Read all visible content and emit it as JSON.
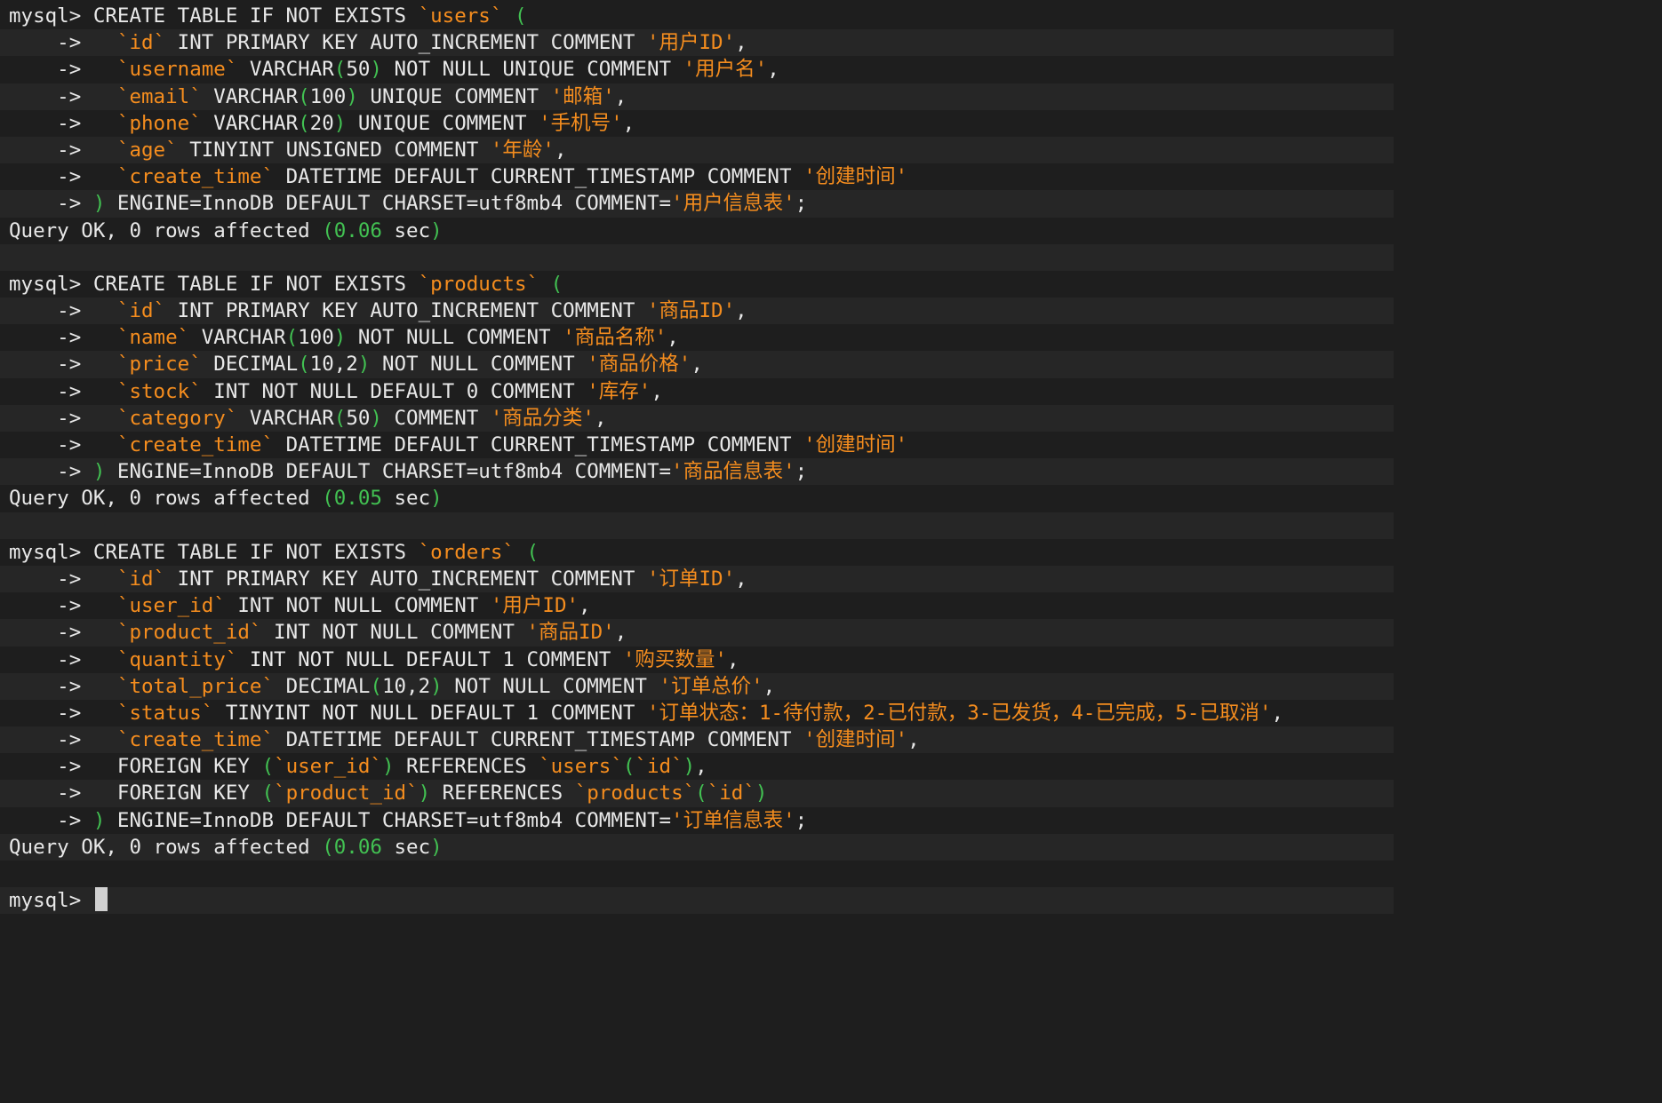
{
  "terminal": {
    "lines": [
      {
        "parts": [
          [
            "n",
            "mysql> CREATE TABLE IF NOT EXISTS "
          ],
          [
            "q",
            "`users`"
          ],
          [
            "n",
            " "
          ],
          [
            "p",
            "("
          ]
        ]
      },
      {
        "parts": [
          [
            "n",
            "    ->   "
          ],
          [
            "q",
            "`id`"
          ],
          [
            "n",
            " INT PRIMARY KEY AUTO_INCREMENT COMMENT "
          ],
          [
            "q",
            "'用户ID'"
          ],
          [
            "n",
            ","
          ]
        ]
      },
      {
        "parts": [
          [
            "n",
            "    ->   "
          ],
          [
            "q",
            "`username`"
          ],
          [
            "n",
            " VARCHAR"
          ],
          [
            "p",
            "("
          ],
          [
            "n",
            "50"
          ],
          [
            "p",
            ")"
          ],
          [
            "n",
            " NOT NULL UNIQUE COMMENT "
          ],
          [
            "q",
            "'用户名'"
          ],
          [
            "n",
            ","
          ]
        ]
      },
      {
        "parts": [
          [
            "n",
            "    ->   "
          ],
          [
            "q",
            "`email`"
          ],
          [
            "n",
            " VARCHAR"
          ],
          [
            "p",
            "("
          ],
          [
            "n",
            "100"
          ],
          [
            "p",
            ")"
          ],
          [
            "n",
            " UNIQUE COMMENT "
          ],
          [
            "q",
            "'邮箱'"
          ],
          [
            "n",
            ","
          ]
        ]
      },
      {
        "parts": [
          [
            "n",
            "    ->   "
          ],
          [
            "q",
            "`phone`"
          ],
          [
            "n",
            " VARCHAR"
          ],
          [
            "p",
            "("
          ],
          [
            "n",
            "20"
          ],
          [
            "p",
            ")"
          ],
          [
            "n",
            " UNIQUE COMMENT "
          ],
          [
            "q",
            "'手机号'"
          ],
          [
            "n",
            ","
          ]
        ]
      },
      {
        "parts": [
          [
            "n",
            "    ->   "
          ],
          [
            "q",
            "`age`"
          ],
          [
            "n",
            " TINYINT UNSIGNED COMMENT "
          ],
          [
            "q",
            "'年龄'"
          ],
          [
            "n",
            ","
          ]
        ]
      },
      {
        "parts": [
          [
            "n",
            "    ->   "
          ],
          [
            "q",
            "`create_time`"
          ],
          [
            "n",
            " DATETIME DEFAULT CURRENT_TIMESTAMP COMMENT "
          ],
          [
            "q",
            "'创建时间'"
          ]
        ]
      },
      {
        "parts": [
          [
            "n",
            "    -> "
          ],
          [
            "p",
            ")"
          ],
          [
            "n",
            " ENGINE=InnoDB DEFAULT CHARSET=utf8mb4 COMMENT="
          ],
          [
            "q",
            "'用户信息表'"
          ],
          [
            "n",
            ";"
          ]
        ]
      },
      {
        "parts": [
          [
            "n",
            "Query OK, 0 rows affected "
          ],
          [
            "p",
            "(0.06"
          ],
          [
            "n",
            " sec"
          ],
          [
            "p",
            ")"
          ]
        ]
      },
      {
        "parts": [
          [
            "n",
            ""
          ]
        ]
      },
      {
        "parts": [
          [
            "n",
            "mysql> CREATE TABLE IF NOT EXISTS "
          ],
          [
            "q",
            "`products`"
          ],
          [
            "n",
            " "
          ],
          [
            "p",
            "("
          ]
        ]
      },
      {
        "parts": [
          [
            "n",
            "    ->   "
          ],
          [
            "q",
            "`id`"
          ],
          [
            "n",
            " INT PRIMARY KEY AUTO_INCREMENT COMMENT "
          ],
          [
            "q",
            "'商品ID'"
          ],
          [
            "n",
            ","
          ]
        ]
      },
      {
        "parts": [
          [
            "n",
            "    ->   "
          ],
          [
            "q",
            "`name`"
          ],
          [
            "n",
            " VARCHAR"
          ],
          [
            "p",
            "("
          ],
          [
            "n",
            "100"
          ],
          [
            "p",
            ")"
          ],
          [
            "n",
            " NOT NULL COMMENT "
          ],
          [
            "q",
            "'商品名称'"
          ],
          [
            "n",
            ","
          ]
        ]
      },
      {
        "parts": [
          [
            "n",
            "    ->   "
          ],
          [
            "q",
            "`price`"
          ],
          [
            "n",
            " DECIMAL"
          ],
          [
            "p",
            "("
          ],
          [
            "n",
            "10,2"
          ],
          [
            "p",
            ")"
          ],
          [
            "n",
            " NOT NULL COMMENT "
          ],
          [
            "q",
            "'商品价格'"
          ],
          [
            "n",
            ","
          ]
        ]
      },
      {
        "parts": [
          [
            "n",
            "    ->   "
          ],
          [
            "q",
            "`stock`"
          ],
          [
            "n",
            " INT NOT NULL DEFAULT 0 COMMENT "
          ],
          [
            "q",
            "'库存'"
          ],
          [
            "n",
            ","
          ]
        ]
      },
      {
        "parts": [
          [
            "n",
            "    ->   "
          ],
          [
            "q",
            "`category`"
          ],
          [
            "n",
            " VARCHAR"
          ],
          [
            "p",
            "("
          ],
          [
            "n",
            "50"
          ],
          [
            "p",
            ")"
          ],
          [
            "n",
            " COMMENT "
          ],
          [
            "q",
            "'商品分类'"
          ],
          [
            "n",
            ","
          ]
        ]
      },
      {
        "parts": [
          [
            "n",
            "    ->   "
          ],
          [
            "q",
            "`create_time`"
          ],
          [
            "n",
            " DATETIME DEFAULT CURRENT_TIMESTAMP COMMENT "
          ],
          [
            "q",
            "'创建时间'"
          ]
        ]
      },
      {
        "parts": [
          [
            "n",
            "    -> "
          ],
          [
            "p",
            ")"
          ],
          [
            "n",
            " ENGINE=InnoDB DEFAULT CHARSET=utf8mb4 COMMENT="
          ],
          [
            "q",
            "'商品信息表'"
          ],
          [
            "n",
            ";"
          ]
        ]
      },
      {
        "parts": [
          [
            "n",
            "Query OK, 0 rows affected "
          ],
          [
            "p",
            "(0.05"
          ],
          [
            "n",
            " sec"
          ],
          [
            "p",
            ")"
          ]
        ]
      },
      {
        "parts": [
          [
            "n",
            ""
          ]
        ]
      },
      {
        "parts": [
          [
            "n",
            "mysql> CREATE TABLE IF NOT EXISTS "
          ],
          [
            "q",
            "`orders`"
          ],
          [
            "n",
            " "
          ],
          [
            "p",
            "("
          ]
        ]
      },
      {
        "parts": [
          [
            "n",
            "    ->   "
          ],
          [
            "q",
            "`id`"
          ],
          [
            "n",
            " INT PRIMARY KEY AUTO_INCREMENT COMMENT "
          ],
          [
            "q",
            "'订单ID'"
          ],
          [
            "n",
            ","
          ]
        ]
      },
      {
        "parts": [
          [
            "n",
            "    ->   "
          ],
          [
            "q",
            "`user_id`"
          ],
          [
            "n",
            " INT NOT NULL COMMENT "
          ],
          [
            "q",
            "'用户ID'"
          ],
          [
            "n",
            ","
          ]
        ]
      },
      {
        "parts": [
          [
            "n",
            "    ->   "
          ],
          [
            "q",
            "`product_id`"
          ],
          [
            "n",
            " INT NOT NULL COMMENT "
          ],
          [
            "q",
            "'商品ID'"
          ],
          [
            "n",
            ","
          ]
        ]
      },
      {
        "parts": [
          [
            "n",
            "    ->   "
          ],
          [
            "q",
            "`quantity`"
          ],
          [
            "n",
            " INT NOT NULL DEFAULT 1 COMMENT "
          ],
          [
            "q",
            "'购买数量'"
          ],
          [
            "n",
            ","
          ]
        ]
      },
      {
        "parts": [
          [
            "n",
            "    ->   "
          ],
          [
            "q",
            "`total_price`"
          ],
          [
            "n",
            " DECIMAL"
          ],
          [
            "p",
            "("
          ],
          [
            "n",
            "10,2"
          ],
          [
            "p",
            ")"
          ],
          [
            "n",
            " NOT NULL COMMENT "
          ],
          [
            "q",
            "'订单总价'"
          ],
          [
            "n",
            ","
          ]
        ]
      },
      {
        "parts": [
          [
            "n",
            "    ->   "
          ],
          [
            "q",
            "`status`"
          ],
          [
            "n",
            " TINYINT NOT NULL DEFAULT 1 COMMENT "
          ],
          [
            "q",
            "'订单状态：1-待付款，2-已付款，3-已发货，4-已完成，5-已取消'"
          ],
          [
            "n",
            ","
          ]
        ]
      },
      {
        "parts": [
          [
            "n",
            "    ->   "
          ],
          [
            "q",
            "`create_time`"
          ],
          [
            "n",
            " DATETIME DEFAULT CURRENT_TIMESTAMP COMMENT "
          ],
          [
            "q",
            "'创建时间'"
          ],
          [
            "n",
            ","
          ]
        ]
      },
      {
        "parts": [
          [
            "n",
            "    ->   FOREIGN KEY "
          ],
          [
            "p",
            "("
          ],
          [
            "q",
            "`user_id`"
          ],
          [
            "p",
            ")"
          ],
          [
            "n",
            " REFERENCES "
          ],
          [
            "q",
            "`users`"
          ],
          [
            "p",
            "("
          ],
          [
            "q",
            "`id`"
          ],
          [
            "p",
            ")"
          ],
          [
            "n",
            ","
          ]
        ]
      },
      {
        "parts": [
          [
            "n",
            "    ->   FOREIGN KEY "
          ],
          [
            "p",
            "("
          ],
          [
            "q",
            "`product_id`"
          ],
          [
            "p",
            ")"
          ],
          [
            "n",
            " REFERENCES "
          ],
          [
            "q",
            "`products`"
          ],
          [
            "p",
            "("
          ],
          [
            "q",
            "`id`"
          ],
          [
            "p",
            ")"
          ]
        ]
      },
      {
        "parts": [
          [
            "n",
            "    -> "
          ],
          [
            "p",
            ")"
          ],
          [
            "n",
            " ENGINE=InnoDB DEFAULT CHARSET=utf8mb4 COMMENT="
          ],
          [
            "q",
            "'订单信息表'"
          ],
          [
            "n",
            ";"
          ]
        ]
      },
      {
        "parts": [
          [
            "n",
            "Query OK, 0 rows affected "
          ],
          [
            "p",
            "(0.06"
          ],
          [
            "n",
            " sec"
          ],
          [
            "p",
            ")"
          ]
        ]
      },
      {
        "parts": [
          [
            "n",
            ""
          ]
        ]
      },
      {
        "parts": [
          [
            "n",
            "mysql> "
          ]
        ],
        "cursor": true
      }
    ],
    "colors": {
      "background": "#1e1e1e",
      "alt_row": "#262626",
      "text": "#e6e6e6",
      "identifier_string": "#f58d1e",
      "paren": "#42c152"
    }
  }
}
